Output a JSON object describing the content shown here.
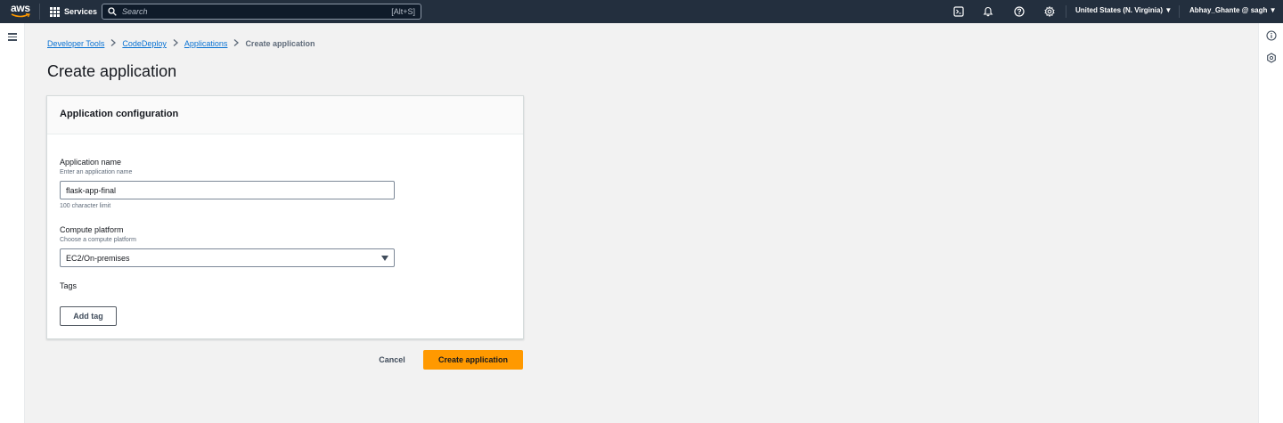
{
  "topnav": {
    "logo_text": "aws",
    "services_label": "Services",
    "search": {
      "placeholder": "Search",
      "shortcut": "[Alt+S]"
    },
    "icons": [
      "cloudshell-icon",
      "notifications-icon",
      "help-icon",
      "settings-icon"
    ],
    "region": "United States (N. Virginia)",
    "account": "Abhay_Ghante @ sagh"
  },
  "breadcrumb": {
    "items": [
      "Developer Tools",
      "CodeDeploy",
      "Applications"
    ],
    "current": "Create application"
  },
  "page": {
    "title": "Create application"
  },
  "panel": {
    "header": "Application configuration",
    "app_name": {
      "label": "Application name",
      "description": "Enter an application name",
      "value": "flask-app-final",
      "constraint": "100 character limit"
    },
    "compute": {
      "label": "Compute platform",
      "description": "Choose a compute platform",
      "selected": "EC2/On-premises"
    },
    "tags": {
      "label": "Tags",
      "add_button": "Add tag"
    }
  },
  "actions": {
    "cancel": "Cancel",
    "submit": "Create application"
  },
  "colors": {
    "nav_bg": "#232f3e",
    "primary_button": "#ff9900",
    "link": "#0972d3"
  }
}
